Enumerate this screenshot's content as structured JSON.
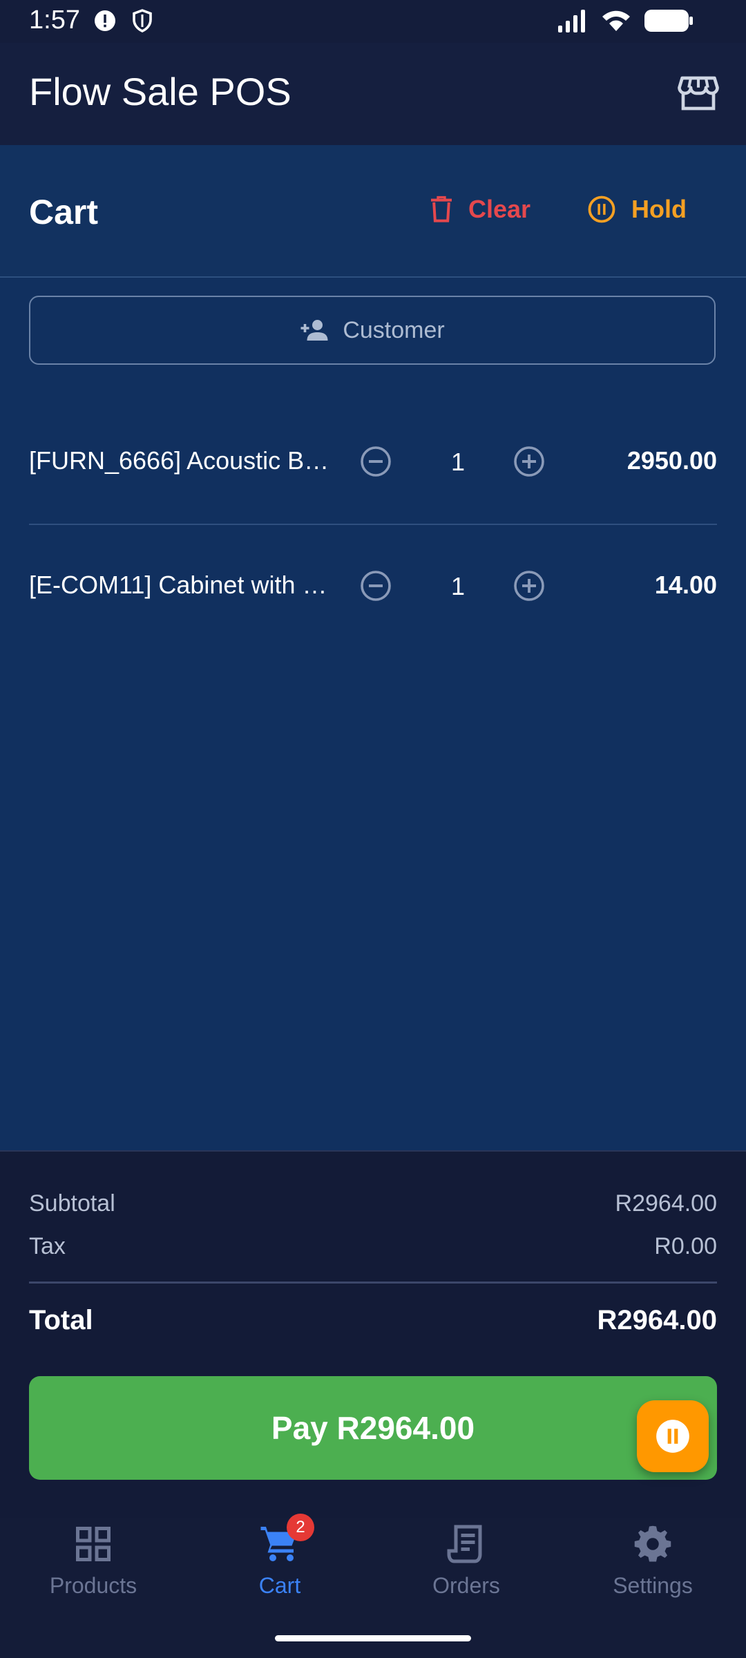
{
  "status_bar": {
    "time": "1:57"
  },
  "app": {
    "title": "Flow Sale POS"
  },
  "cart": {
    "title": "Cart",
    "clear_label": "Clear",
    "hold_label": "Hold",
    "customer_label": "Customer",
    "items": [
      {
        "name": "[FURN_6666] Acoustic B…",
        "qty": "1",
        "price": "2950.00"
      },
      {
        "name": "[E-COM11] Cabinet with …",
        "qty": "1",
        "price": "14.00"
      }
    ]
  },
  "summary": {
    "subtotal_label": "Subtotal",
    "subtotal_value": "R2964.00",
    "tax_label": "Tax",
    "tax_value": "R0.00",
    "total_label": "Total",
    "total_value": "R2964.00",
    "pay_label": "Pay R2964.00"
  },
  "nav": {
    "items": [
      {
        "label": "Products",
        "icon": "grid-icon"
      },
      {
        "label": "Cart",
        "icon": "cart-icon",
        "badge": "2",
        "active": true
      },
      {
        "label": "Orders",
        "icon": "receipt-icon"
      },
      {
        "label": "Settings",
        "icon": "gear-icon"
      }
    ]
  },
  "colors": {
    "background": "#111a35",
    "panel": "#11305f",
    "clear": "#e5484d",
    "hold": "#f5a023",
    "pay": "#4caf50",
    "active_nav": "#3b82f6",
    "badge": "#e53935"
  }
}
